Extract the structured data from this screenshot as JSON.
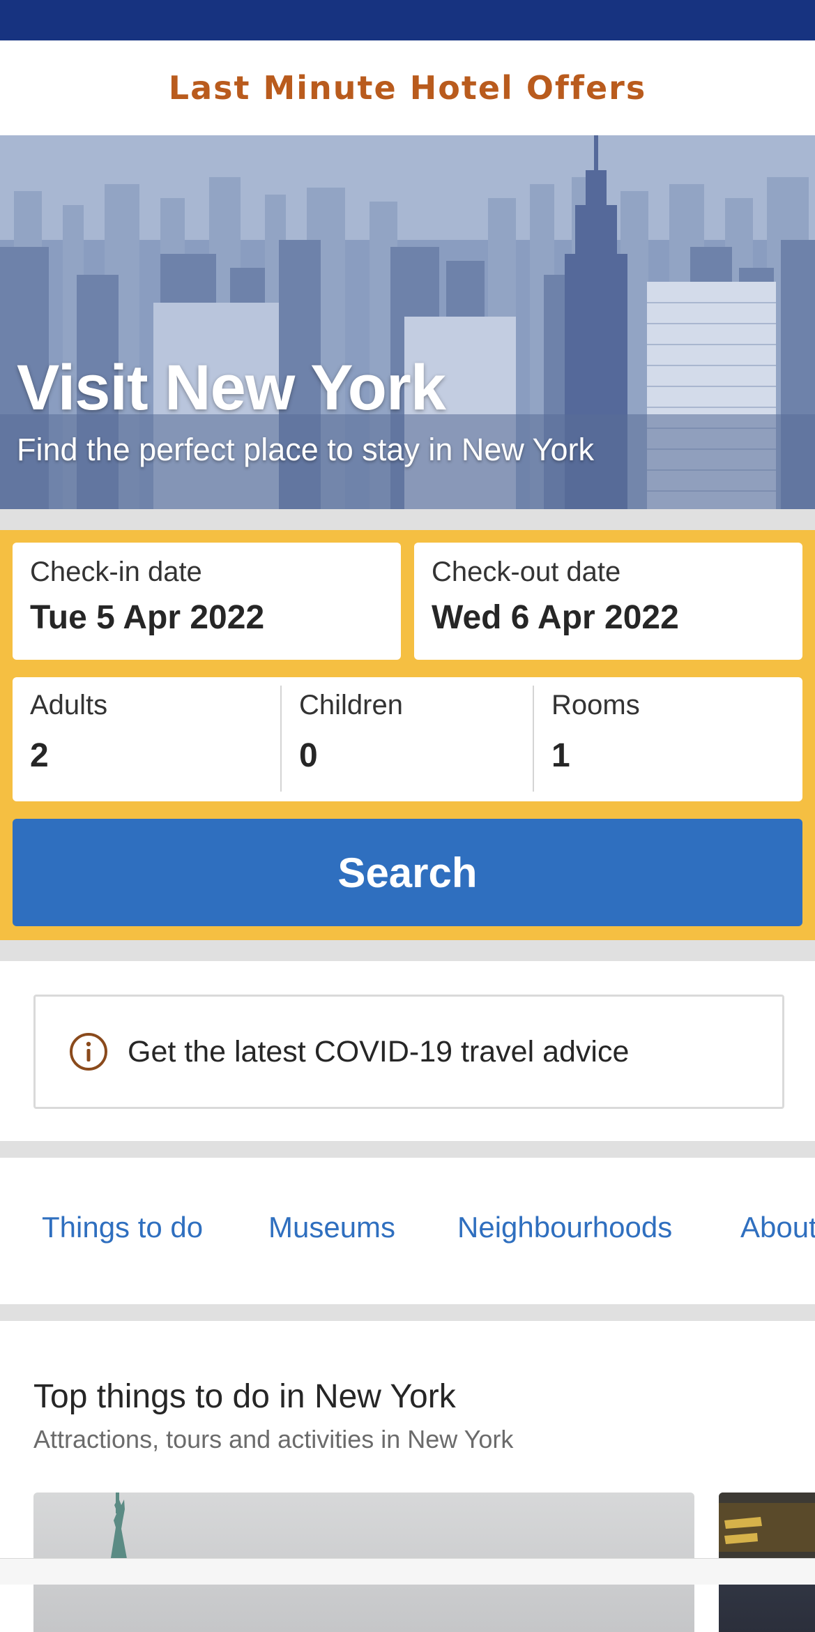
{
  "header": {
    "logo_text": "Last Minute Hotel Offers"
  },
  "hero": {
    "title": "Visit New York",
    "subtitle": "Find the perfect place to stay in New York"
  },
  "search": {
    "checkin_label": "Check-in date",
    "checkin_value": "Tue 5 Apr 2022",
    "checkout_label": "Check-out date",
    "checkout_value": "Wed 6 Apr 2022",
    "adults_label": "Adults",
    "adults_value": "2",
    "children_label": "Children",
    "children_value": "0",
    "rooms_label": "Rooms",
    "rooms_value": "1",
    "button_label": "Search"
  },
  "notice": {
    "text": "Get the latest COVID-19 travel advice"
  },
  "nav": {
    "tabs": [
      {
        "label": "Things to do"
      },
      {
        "label": "Museums"
      },
      {
        "label": "Neighbourhoods"
      },
      {
        "label": "About"
      }
    ]
  },
  "section": {
    "title": "Top things to do in New York",
    "subtitle": "Attractions, tours and activities in New York"
  },
  "colors": {
    "status_bar": "#173380",
    "logo": "#b95b1d",
    "search_panel": "#f5bf42",
    "search_button": "#2f6fbf",
    "link": "#2f6fbf"
  },
  "icons": {
    "info": "info-circle-icon"
  }
}
